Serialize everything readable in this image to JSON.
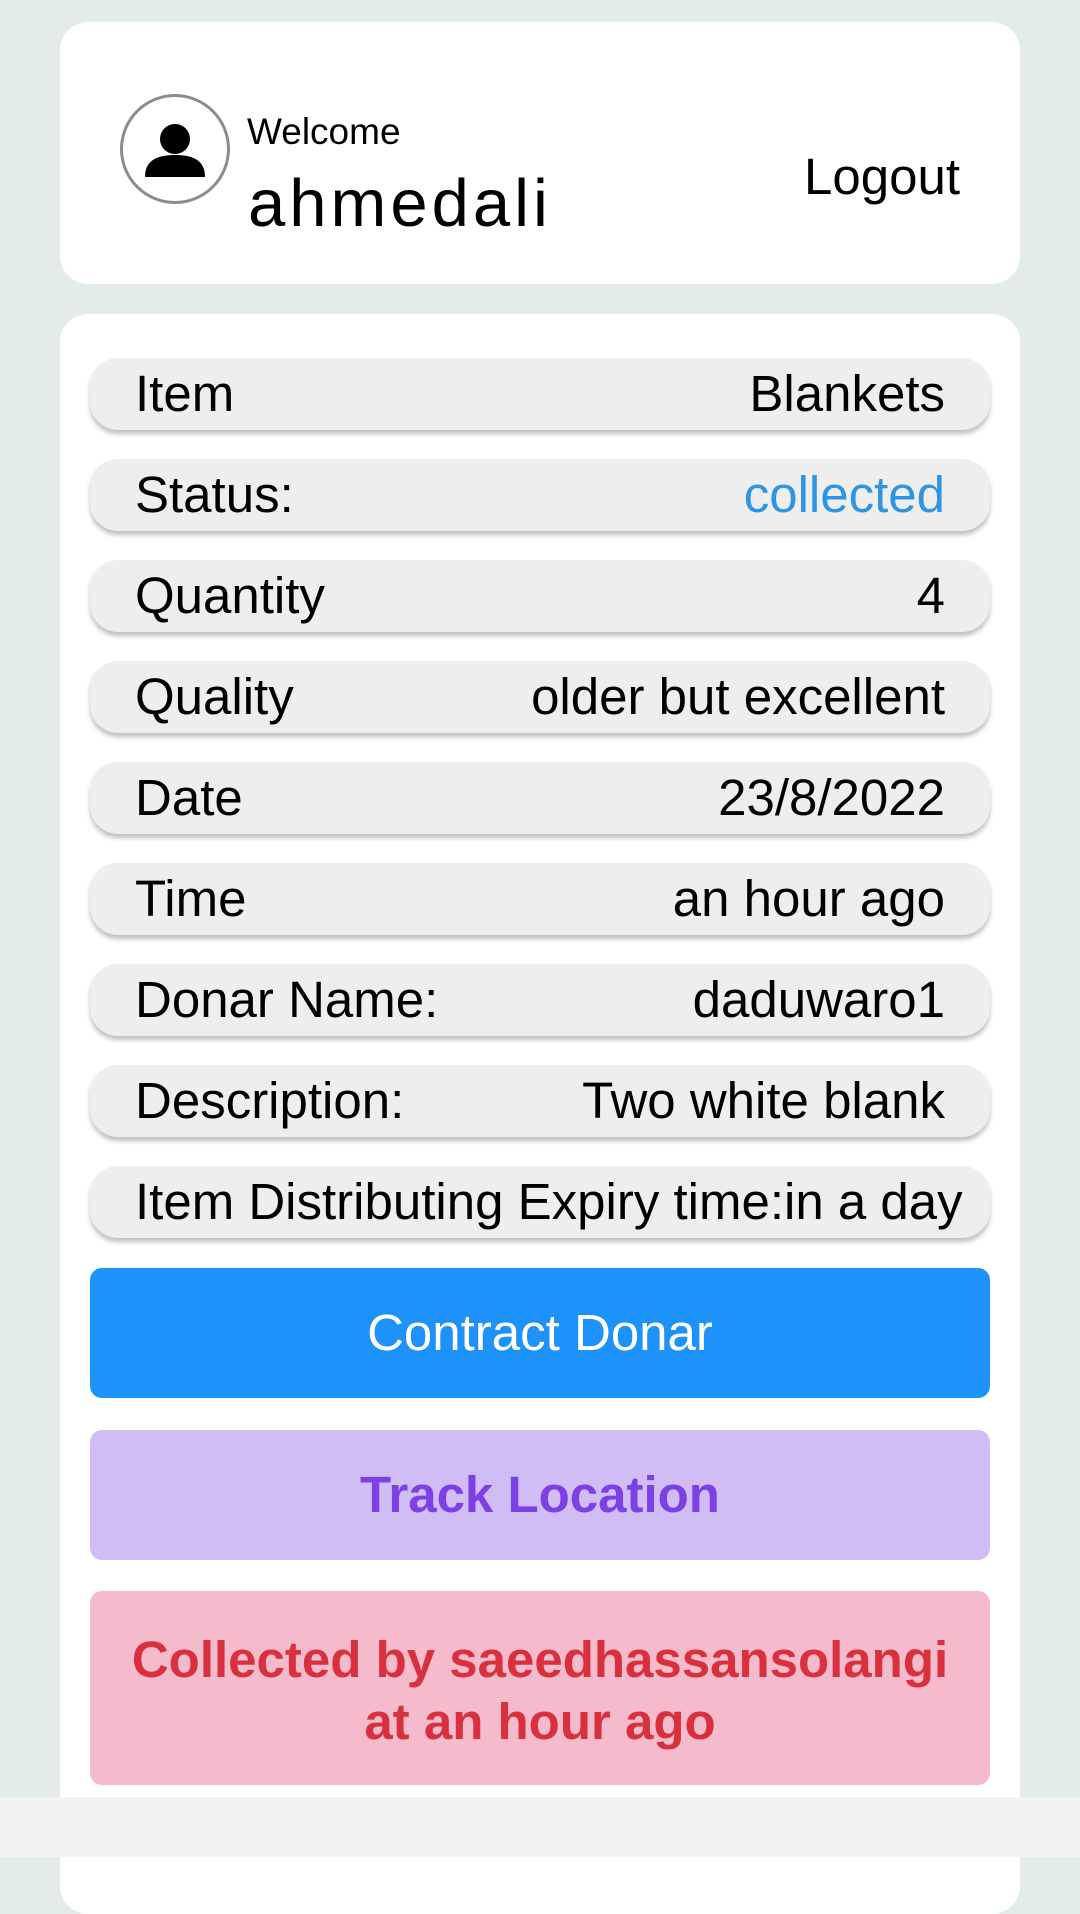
{
  "header": {
    "welcome_label": "Welcome",
    "username": "ahmedali",
    "logout_label": "Logout",
    "avatar_icon": "user-avatar-icon"
  },
  "details": {
    "item": {
      "label": "Item",
      "value": "Blankets"
    },
    "status": {
      "label": "Status:",
      "value": "collected"
    },
    "quantity": {
      "label": "Quantity",
      "value": "4"
    },
    "quality": {
      "label": "Quality",
      "value": "older but excellent"
    },
    "date": {
      "label": "Date",
      "value": "23/8/2022"
    },
    "time": {
      "label": "Time",
      "value": "an hour ago"
    },
    "donor_name": {
      "label": "Donar Name:",
      "value": "daduwaro1"
    },
    "description": {
      "label": "Description:",
      "value": "Two white blank"
    },
    "expiry": {
      "text": "Item Distributing Expiry time:in a day"
    }
  },
  "actions": {
    "contact_label": "Contract Donar",
    "track_label": "Track Location"
  },
  "collected_notice": {
    "line1": "Collected by saeedhassansolangi",
    "line2": "at an hour ago"
  },
  "colors": {
    "page_background": "#e3ece6",
    "status_blue": "#2e95e6",
    "contact_button": "#1e92fb",
    "track_button_bg": "#d1bdf5",
    "track_button_text": "#7d3fe6",
    "collected_bg": "#f5bacb",
    "collected_text": "#d9303d"
  }
}
